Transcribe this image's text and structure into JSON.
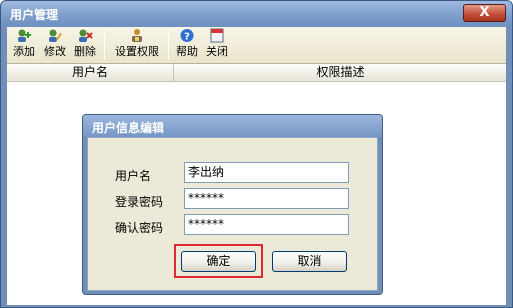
{
  "window": {
    "title": "用户管理",
    "close_glyph": "X"
  },
  "toolbar": {
    "items": [
      {
        "label": "添加",
        "icon": "add-icon"
      },
      {
        "label": "修改",
        "icon": "edit-icon"
      },
      {
        "label": "删除",
        "icon": "delete-icon"
      },
      {
        "label": "设置权限",
        "icon": "permission-icon"
      },
      {
        "label": "帮助",
        "icon": "help-icon"
      },
      {
        "label": "关闭",
        "icon": "close-window-icon"
      }
    ]
  },
  "grid": {
    "columns": [
      "用户名",
      "权限描述"
    ]
  },
  "dialog": {
    "title": "用户信息编辑",
    "fields": [
      {
        "label": "用户名",
        "value": "李出纳"
      },
      {
        "label": "登录密码",
        "value": "******"
      },
      {
        "label": "确认密码",
        "value": "******"
      }
    ],
    "ok_label": "确定",
    "cancel_label": "取消"
  },
  "colors": {
    "highlight": "#e0282f",
    "title_bar": "#7e9ecb",
    "toolbar": "#f2f0e0"
  }
}
